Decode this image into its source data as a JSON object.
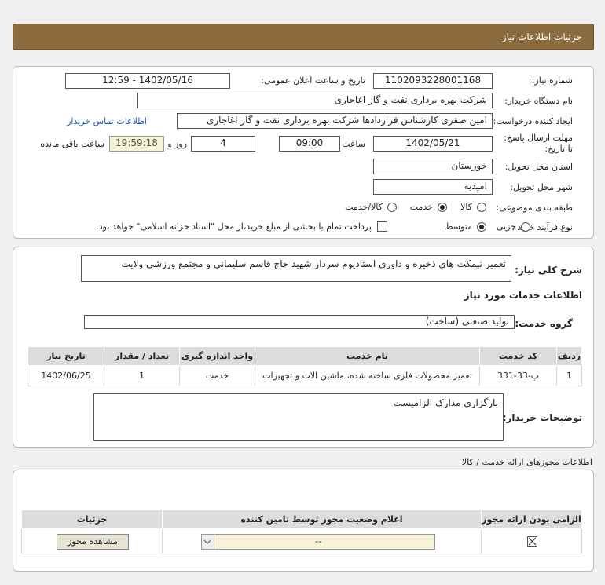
{
  "header": {
    "title": "جزئیات اطلاعات نیاز"
  },
  "form": {
    "need_number_label": "شماره نیاز:",
    "need_number": "1102093228001168",
    "announce_label": "تاریخ و ساعت اعلان عمومی:",
    "announce_value": "1402/05/16 - 12:59",
    "buyer_org_label": "نام دستگاه خریدار:",
    "buyer_org": "شرکت بهره برداری نفت و گاز اغاجاری",
    "creator_label": "ایجاد کننده درخواست:",
    "creator": "امین صفری کارشناس قراردادها شرکت بهره برداری نفت و گاز اغاجاری",
    "contact_link": "اطلاعات تماس خریدار",
    "deadline_label": "مهلت ارسال پاسخ: تا تاریخ:",
    "deadline_date": "1402/05/21",
    "time_label": "ساعت",
    "deadline_time": "09:00",
    "days": "4",
    "days_label": "روز و",
    "remaining_time": "19:59:18",
    "remaining_label": "ساعت باقی مانده",
    "province_label": "استان محل تحویل:",
    "province": "خوزستان",
    "city_label": "شهر محل تحویل:",
    "city": "امیدیه",
    "category_label": "طبقه بندی موضوعی:",
    "category_options": [
      "کالا",
      "خدمت",
      "کالا/خدمت"
    ],
    "category_selected": "خدمت",
    "process_label": "نوع فرآیند خرید :",
    "process_options": [
      "جزیی",
      "متوسط"
    ],
    "process_selected": "متوسط",
    "payment_note": "پرداخت تمام یا بخشی از مبلغ خرید،از محل \"اسناد خزانه اسلامی\" خواهد بود."
  },
  "description": {
    "label": "شرح کلی نیاز:",
    "text": "تعمیر نیمکت های ذخیره و داوری استادیوم سردار شهید حاج قاسم سلیمانی و مجتمع ورزشی ولایت"
  },
  "services": {
    "section_title": "اطلاعات خدمات مورد نیاز",
    "group_label": "گروه خدمت:",
    "group_value": "تولید صنعتی (ساخت)",
    "columns": [
      "ردیف",
      "کد خدمت",
      "نام خدمت",
      "واحد اندازه گیری",
      "تعداد / مقدار",
      "تاریخ نیاز"
    ],
    "rows": [
      {
        "row": "1",
        "code": "پ-33-331",
        "name": "تعمیر محصولات فلزی ساخته شده، ماشین آلات و تجهیزات",
        "unit": "خدمت",
        "qty": "1",
        "date": "1402/06/25"
      }
    ],
    "buyer_notes_label": "توضیحات خریدار:",
    "buyer_notes": "بارگزاری مدارک الزامیست"
  },
  "licenses": {
    "section_title": "اطلاعات مجوزهای ارائه خدمت / کالا",
    "columns": [
      "الزامی بودن ارائه مجوز",
      "اعلام وضعیت مجوز توسط تامین کننده",
      "جزئیات"
    ],
    "select_value": "--",
    "view_button": "مشاهده مجوز"
  }
}
